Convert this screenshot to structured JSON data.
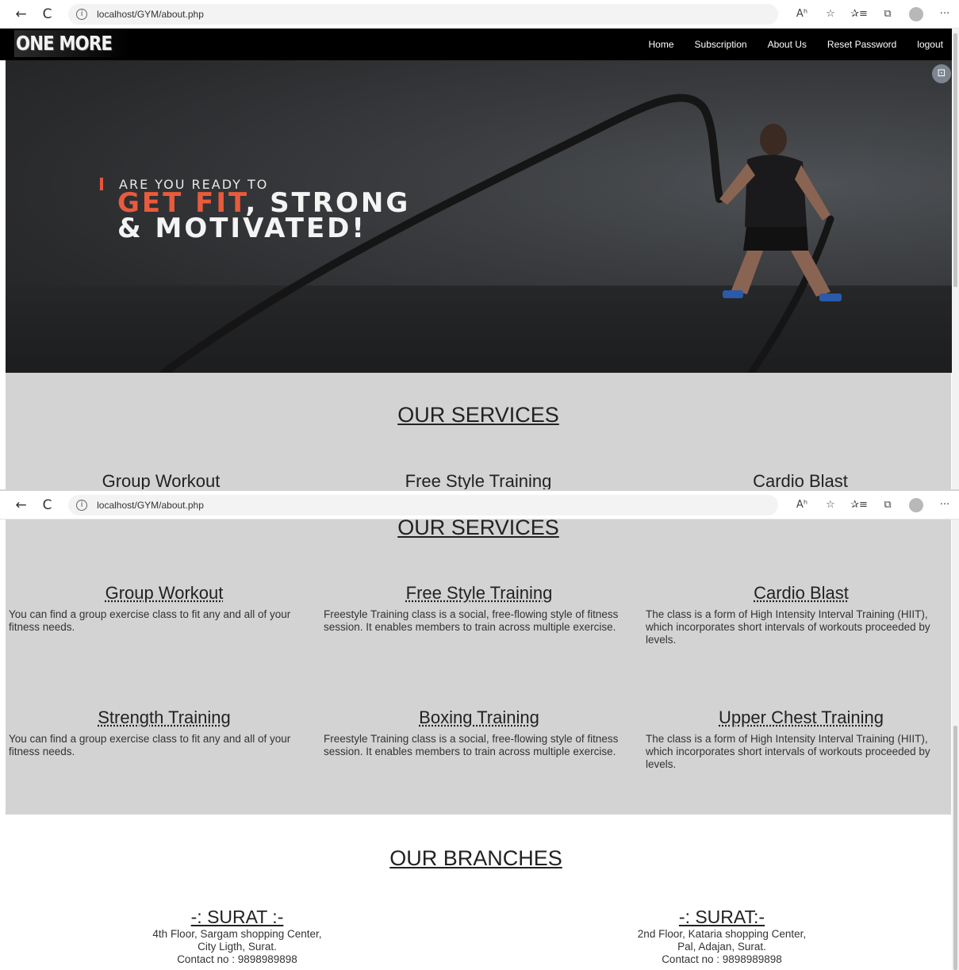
{
  "browser": {
    "url": "localhost/GYM/about.php",
    "back_glyph": "←",
    "refresh_glyph": "C",
    "info_glyph": "i",
    "tools": [
      "Aʰ",
      "☆",
      "✰≡",
      "⧉",
      "···"
    ]
  },
  "site": {
    "logo": "ONE MORE",
    "nav": [
      "Home",
      "Subscription",
      "About Us",
      "Reset Password",
      "logout"
    ]
  },
  "hero": {
    "line1": "ARE YOU READY TO",
    "accent": "GET FIT",
    "line2_rest": ", STRONG",
    "line3": "& MOTIVATED!",
    "screen_icon": "⊡"
  },
  "services": {
    "title": "OUR SERVICES",
    "items": [
      {
        "name": "Group Workout",
        "desc": "You can find a group exercise class to fit any and all of your fitness needs."
      },
      {
        "name": "Free Style Training",
        "desc": "Freestyle Training class is a social, free-flowing style of fitness session. It enables members to train across multiple exercise."
      },
      {
        "name": "Cardio Blast",
        "desc": "The class is a form of High Intensity Interval Training (HIIT), which incorporates short intervals of workouts proceeded by levels."
      },
      {
        "name": "Strength Training",
        "desc": "You can find a group exercise class to fit any and all of your fitness needs."
      },
      {
        "name": "Boxing Training",
        "desc": "Freestyle Training class is a social, free-flowing style of fitness session. It enables members to train across multiple exercise."
      },
      {
        "name": "Upper Chest Training",
        "desc": "The class is a form of High Intensity Interval Training (HIIT), which incorporates short intervals of workouts proceeded by levels."
      }
    ]
  },
  "branches": {
    "title": "OUR BRANCHES",
    "items": [
      {
        "name": "-: SURAT :-",
        "address1": "4th Floor, Sargam shopping Center,",
        "address2": "City Ligth, Surat.",
        "contact": "Contact no : 9898989898"
      },
      {
        "name": "-: SURAT:-",
        "address1": "2nd Floor, Kataria shopping Center,",
        "address2": "Pal, Adajan, Surat.",
        "contact": "Contact no : 9898989898"
      }
    ]
  },
  "colors": {
    "accent": "#e85b3c",
    "nav_bg": "#000000",
    "section_bg": "#d3d3d3"
  }
}
